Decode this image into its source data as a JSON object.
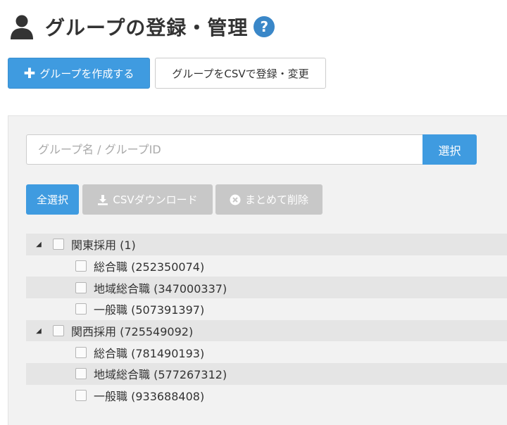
{
  "header": {
    "title": "グループの登録・管理",
    "help_symbol": "?"
  },
  "actions": {
    "create_label": "グループを作成する",
    "create_icon": "plus-icon",
    "csv_register_label": "グループをCSVで登録・変更"
  },
  "search": {
    "placeholder": "グループ名 / グループID",
    "value": "",
    "submit_label": "選択"
  },
  "toolbar": {
    "select_all_label": "全選択",
    "download_label": "CSVダウンロード",
    "download_icon": "download-icon",
    "delete_label": "まとめて削除",
    "delete_icon": "close-circle-icon"
  },
  "tree": {
    "toggle_symbol": "◢",
    "rows": [
      {
        "level": 0,
        "label": "関東採用 (1)"
      },
      {
        "level": 1,
        "label": "総合職 (252350074)"
      },
      {
        "level": 1,
        "label": "地域総合職 (347000337)"
      },
      {
        "level": 1,
        "label": "一般職 (507391397)"
      },
      {
        "level": 0,
        "label": "関西採用 (725549092)"
      },
      {
        "level": 1,
        "label": "総合職 (781490193)"
      },
      {
        "level": 1,
        "label": "地域総合職 (577267312)"
      },
      {
        "level": 1,
        "label": "一般職 (933688408)"
      }
    ]
  },
  "colors": {
    "primary": "#3f9be0",
    "disabled": "#c8c8c8",
    "help": "#3a87c8",
    "panel": "#f2f2f2"
  }
}
